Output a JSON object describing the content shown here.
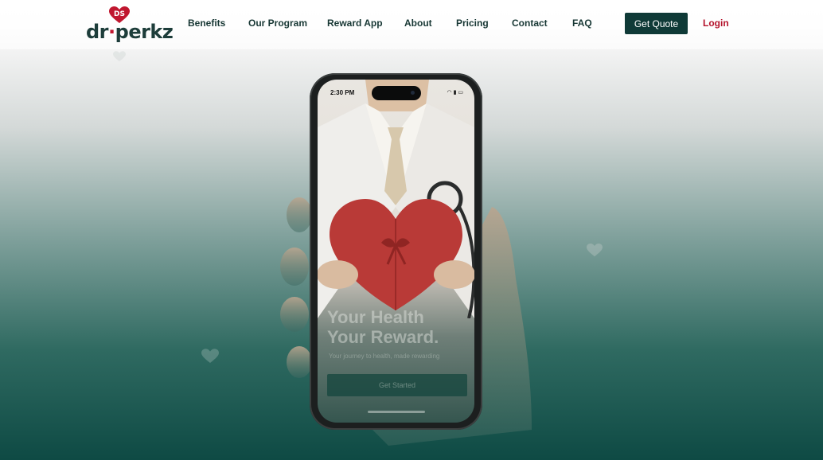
{
  "brand": {
    "logo_text": "dr",
    "logo_text2": "perkz",
    "logo_mark": "DS"
  },
  "nav": {
    "items": [
      "Benefits",
      "Our Program",
      "Reward App",
      "About",
      "Pricing",
      "Contact",
      "FAQ"
    ],
    "cta_label": "Get Quote",
    "login_label": "Login"
  },
  "phone": {
    "time": "2:30 PM",
    "headline_line1": "Your Health",
    "headline_line2": "Your Reward.",
    "subtitle": "Your journey to health, made rewarding",
    "button_label": "Get Started"
  },
  "colors": {
    "primary": "#0f3a37",
    "accent": "#b4122b",
    "text": "#173734"
  }
}
